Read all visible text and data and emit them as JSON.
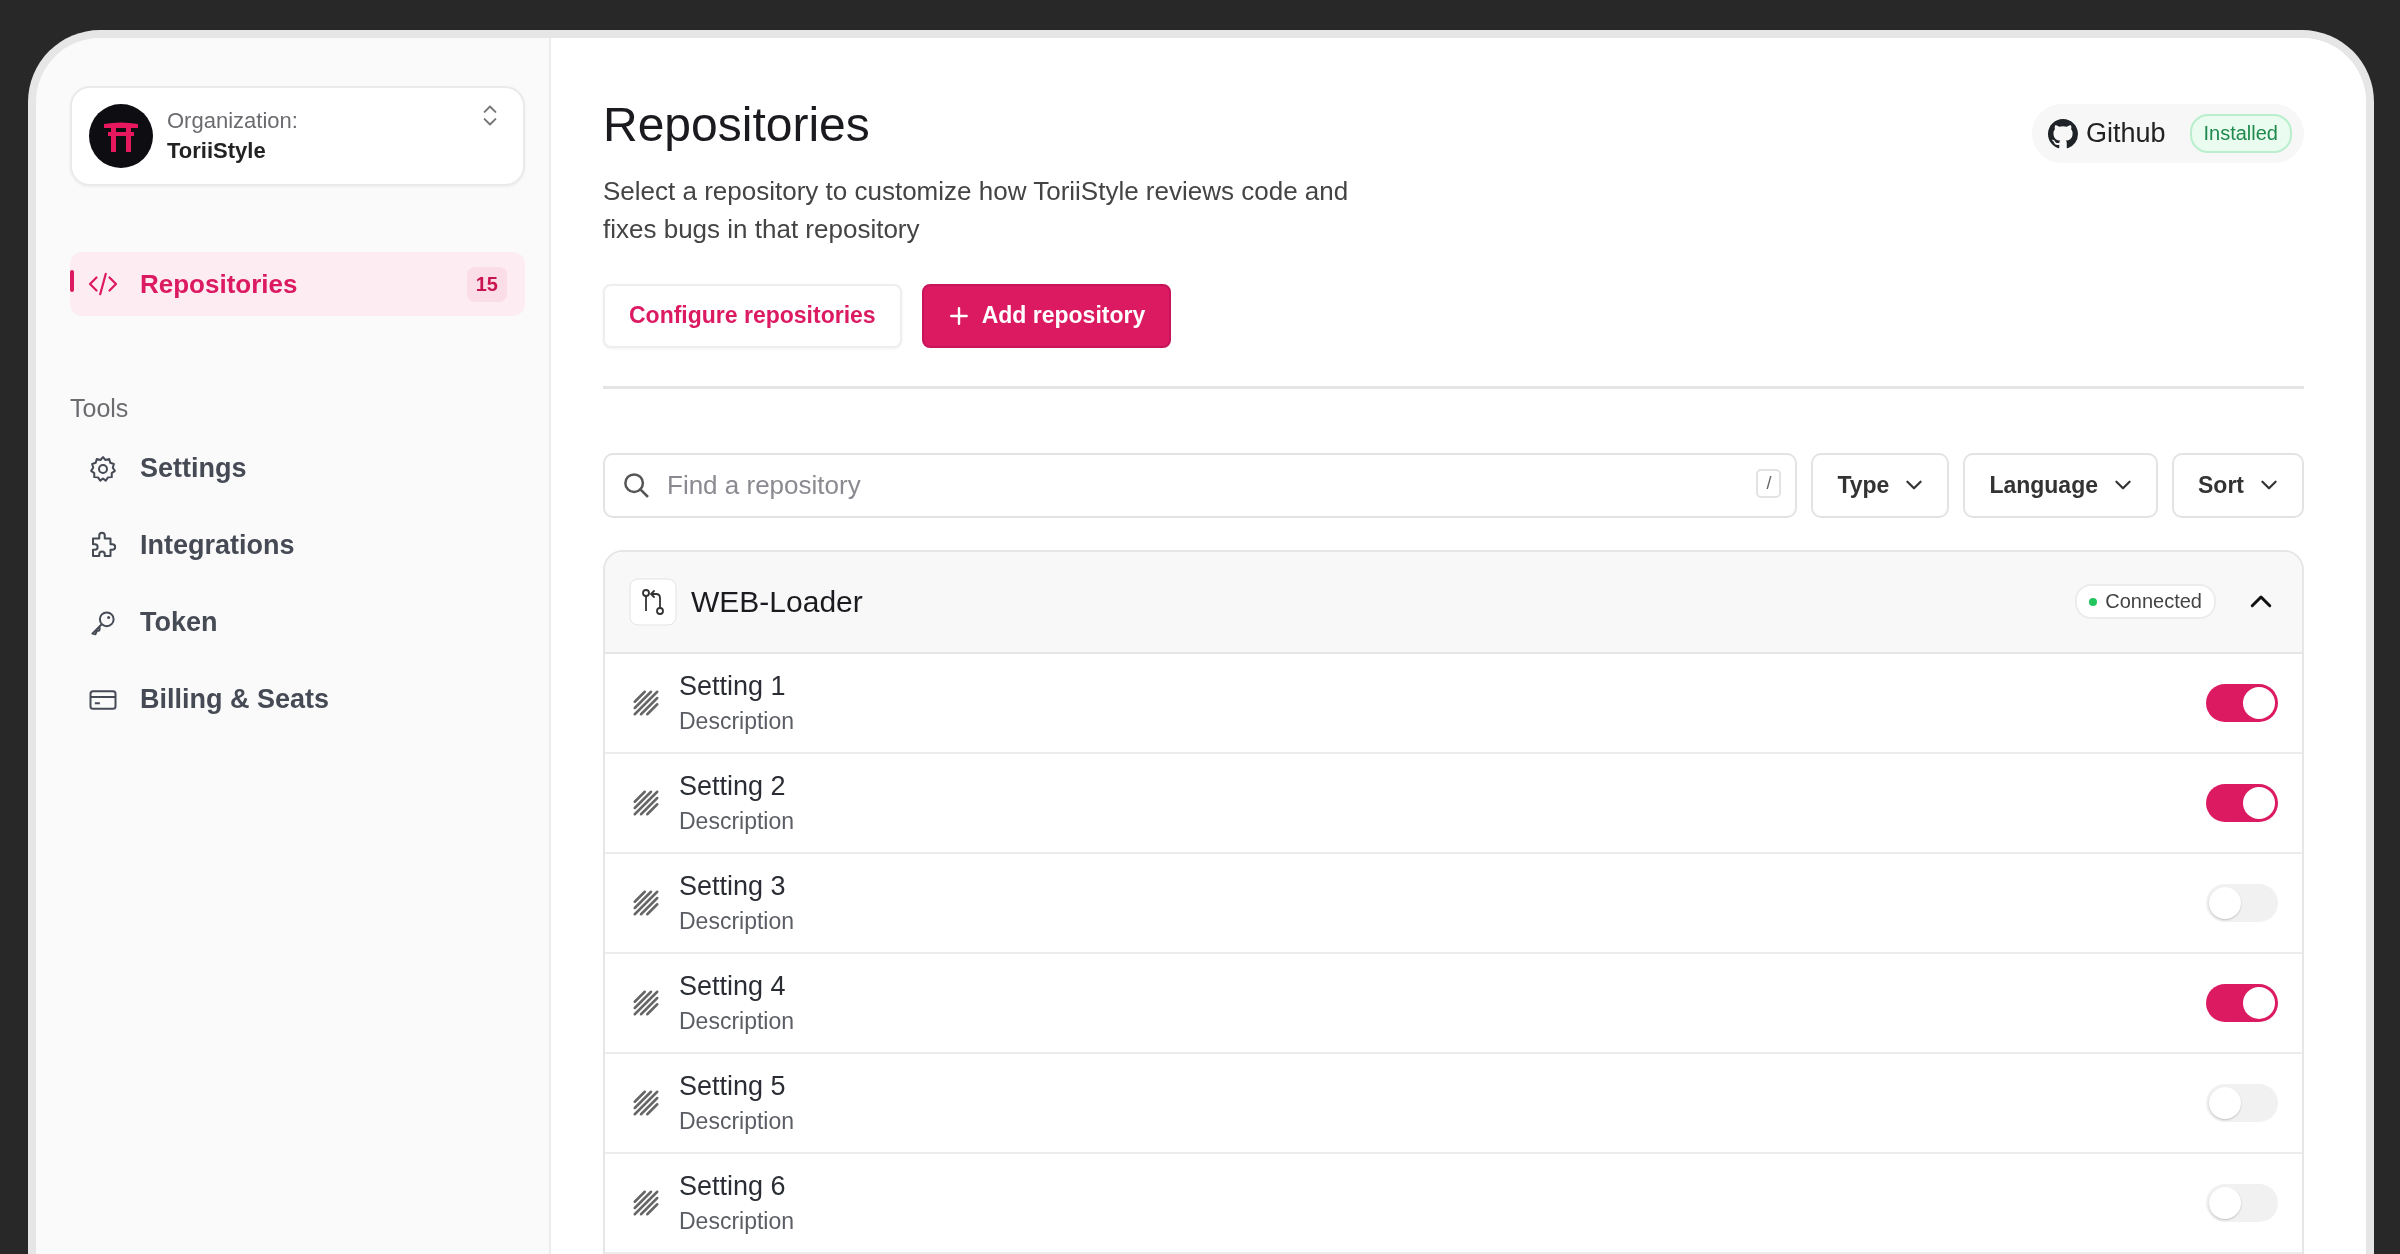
{
  "organization": {
    "label": "Organization:",
    "name": "ToriiStyle"
  },
  "nav": [
    {
      "label": "Repositories",
      "count": "15",
      "selected": true
    }
  ],
  "tools": {
    "heading": "Tools",
    "items": [
      {
        "label": "Settings",
        "selected": false
      },
      {
        "label": "Integrations",
        "selected": false
      },
      {
        "label": "Token",
        "selected": false
      },
      {
        "label": "Billing & Seats",
        "selected": false
      }
    ]
  },
  "header": {
    "title": "Repositories",
    "description": "Select a repository to customize how ToriiStyle reviews code and fixes bugs in that repository",
    "buttons": [
      "Configure repositories",
      "Add repository"
    ]
  },
  "integration": {
    "name": "Github",
    "status": "Installed"
  },
  "search": {
    "placeholder": "Find a repository",
    "shortcut": "/"
  },
  "filters": [
    "Type",
    "Language",
    "Sort"
  ],
  "repository": {
    "name": "WEB-Loader",
    "status": "Connected",
    "expanded": true,
    "settings": [
      {
        "name": "Setting 1",
        "description": "Description",
        "on": true
      },
      {
        "name": "Setting 2",
        "description": "Description",
        "on": true
      },
      {
        "name": "Setting 3",
        "description": "Description",
        "on": false
      },
      {
        "name": "Setting 4",
        "description": "Description",
        "on": true
      },
      {
        "name": "Setting 5",
        "description": "Description",
        "on": false
      },
      {
        "name": "Setting 6",
        "description": "Description",
        "on": false
      }
    ]
  }
}
